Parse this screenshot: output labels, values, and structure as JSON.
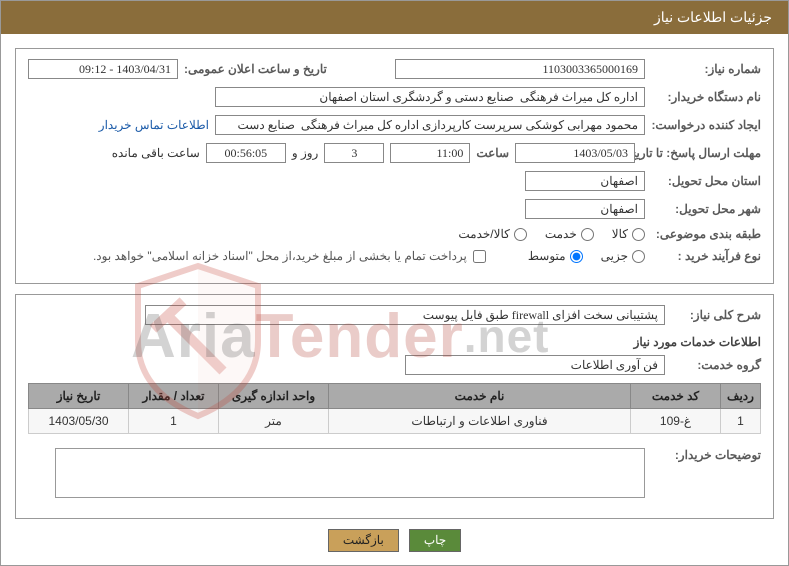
{
  "title": "جزئیات اطلاعات نیاز",
  "fields": {
    "need_no_label": "شماره نیاز:",
    "need_no": "1103003365000169",
    "announce_label": "تاریخ و ساعت اعلان عمومی:",
    "announce_value": "1403/04/31 - 09:12",
    "buyer_org_label": "نام دستگاه خریدار:",
    "buyer_org": "اداره کل میراث فرهنگی  صنایع دستی و گردشگری استان اصفهان",
    "requester_label": "ایجاد کننده درخواست:",
    "requester_value": "محمود مهرابی کوشکی سرپرست کارپردازی اداره کل میراث فرهنگی  صنایع دست",
    "contact_link": "اطلاعات تماس خریدار",
    "deadline_label": "مهلت ارسال پاسخ: تا تاریخ:",
    "deadline_date": "1403/05/03",
    "time_label": "ساعت",
    "deadline_time": "11:00",
    "days_value": "3",
    "days_and": "روز و",
    "hms_value": "00:56:05",
    "remaining_label": "ساعت باقی مانده",
    "deliver_province_label": "استان محل تحویل:",
    "deliver_province": "اصفهان",
    "deliver_city_label": "شهر محل تحویل:",
    "deliver_city": "اصفهان",
    "subject_cat_label": "طبقه بندی موضوعی:",
    "radio_goods": "کالا",
    "radio_service": "خدمت",
    "radio_both": "کالا/خدمت",
    "process_type_label": "نوع فرآیند خرید :",
    "radio_minor": "جزیی",
    "radio_medium": "متوسط",
    "payment_note": "پرداخت تمام یا بخشی از مبلغ خرید،از محل \"اسناد خزانه اسلامی\" خواهد بود.",
    "need_desc_label": "شرح کلی نیاز:",
    "need_desc_value": "پشتیبانی سخت افزای firewall طبق فایل پیوست",
    "services_heading": "اطلاعات خدمات مورد نیاز",
    "service_group_label": "گروه خدمت:",
    "service_group_value": "فن آوری اطلاعات",
    "buyer_notes_label": "توضیحات خریدار:"
  },
  "table": {
    "headers": {
      "row": "ردیف",
      "code": "کد خدمت",
      "name": "نام خدمت",
      "unit": "واحد اندازه گیری",
      "qty": "تعداد / مقدار",
      "date": "تاریخ نیاز"
    },
    "rows": [
      {
        "idx": "1",
        "code": "غ-109",
        "name": "فناوری اطلاعات و ارتباطات",
        "unit": "متر",
        "qty": "1",
        "date": "1403/05/30"
      }
    ]
  },
  "buttons": {
    "print": "چاپ",
    "back": "بازگشت"
  },
  "watermark": "AriaTender.net"
}
